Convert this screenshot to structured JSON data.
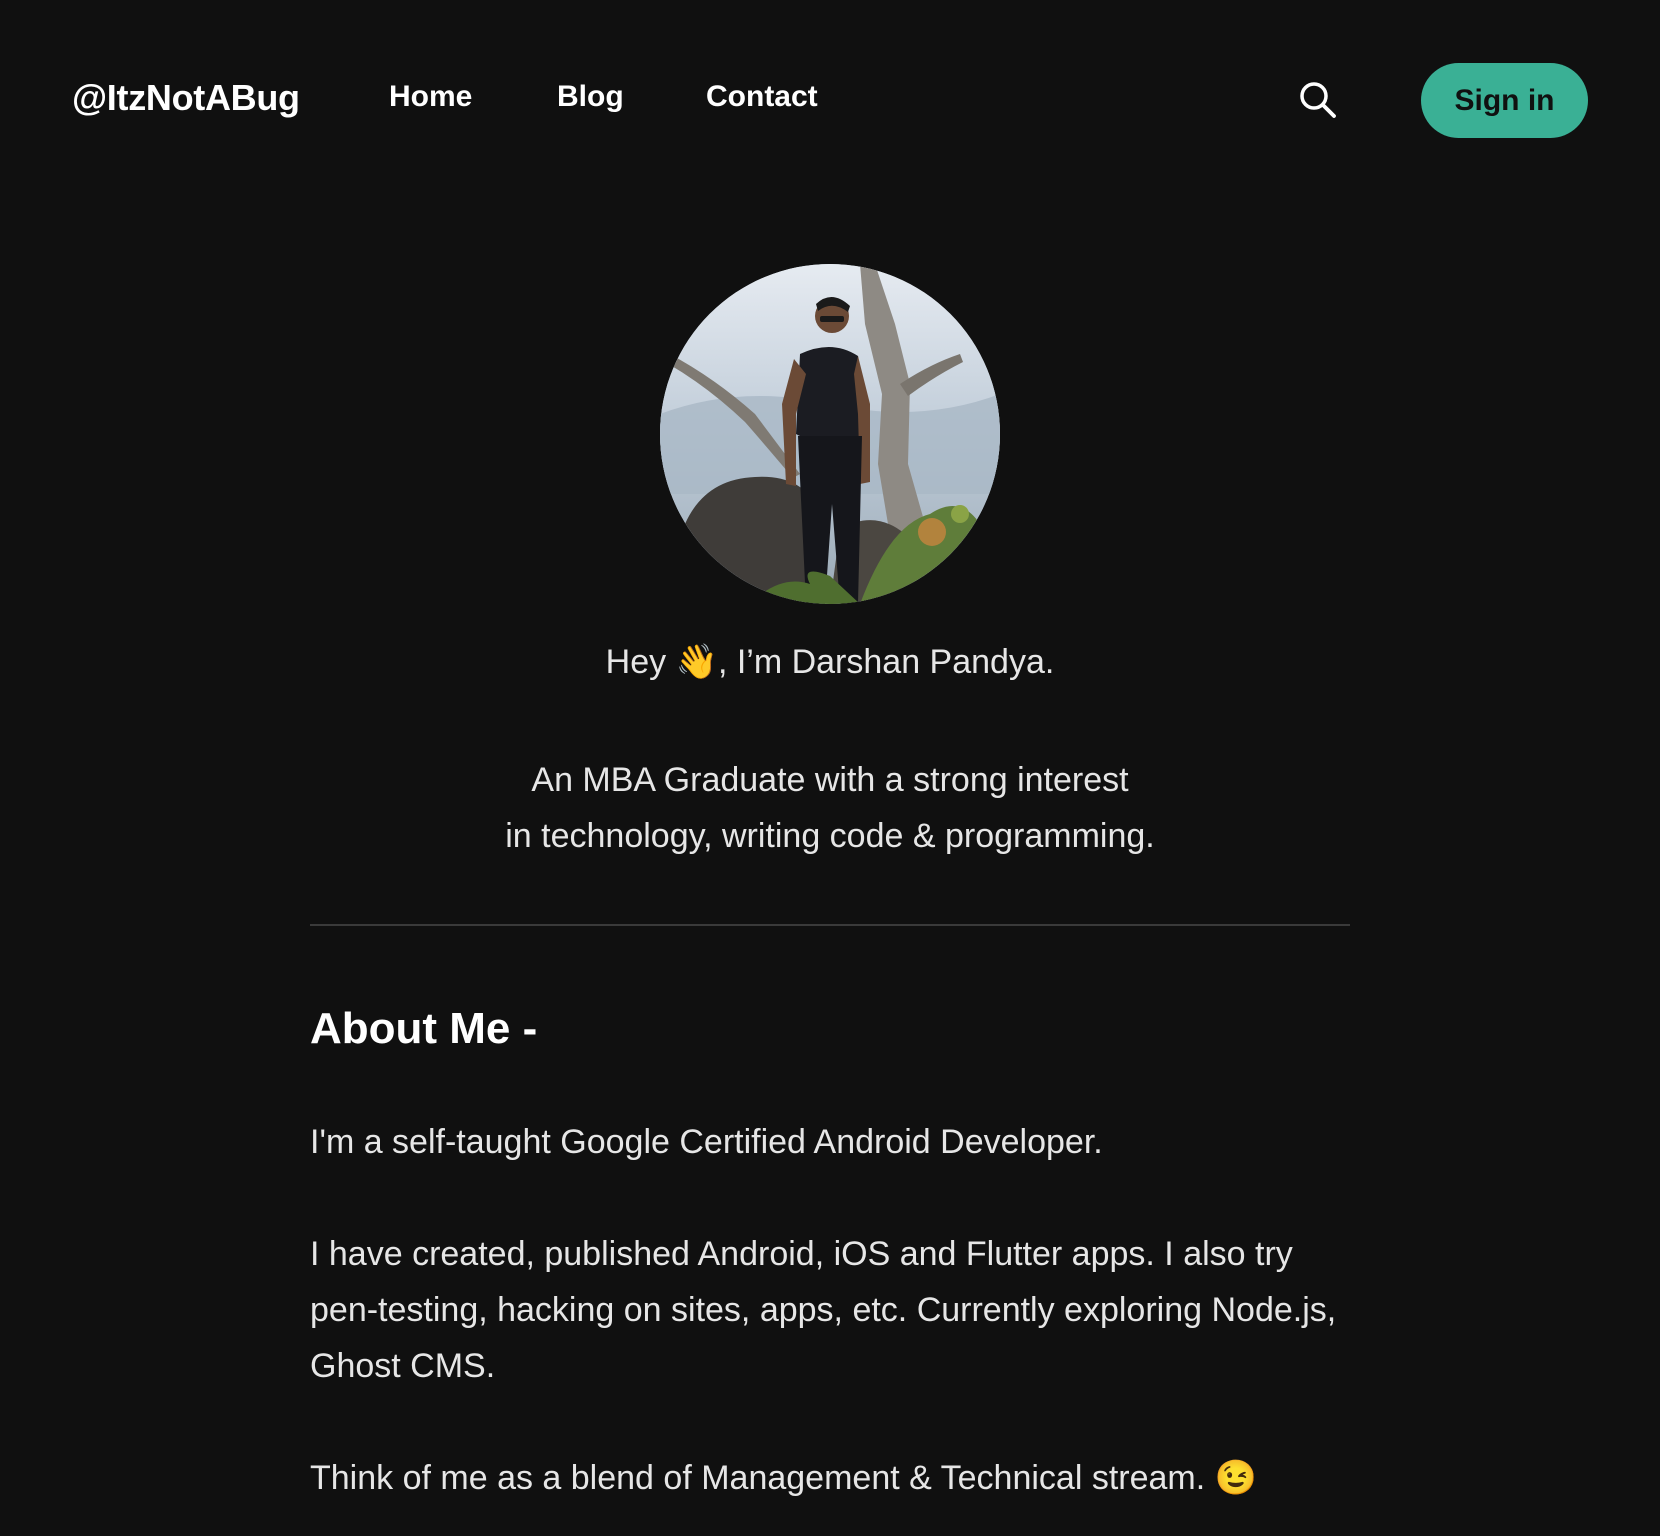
{
  "header": {
    "brand": "@ItzNotABug",
    "nav": [
      "Home",
      "Blog",
      "Contact"
    ],
    "sign_in_label": "Sign in",
    "search_icon": "search-icon",
    "accent_color": "#3ab095"
  },
  "hero": {
    "greeting_prefix": "Hey ",
    "greeting_emoji": "👋",
    "greeting_suffix": ", I’m Darshan Pandya.",
    "tagline_line1": "An MBA Graduate with a strong interest",
    "tagline_line2": "in technology, writing code & programming."
  },
  "about": {
    "title": "About Me -",
    "paragraph1": "I'm a self-taught Google Certified Android Developer.",
    "paragraph2": "I have created, published Android, iOS and Flutter apps. I also try pen-testing, hacking on sites, apps, etc. Currently exploring Node.js, Ghost CMS.",
    "paragraph3_text": "Think of me as a blend of Management & Technical stream. ",
    "paragraph3_emoji": "😉"
  }
}
